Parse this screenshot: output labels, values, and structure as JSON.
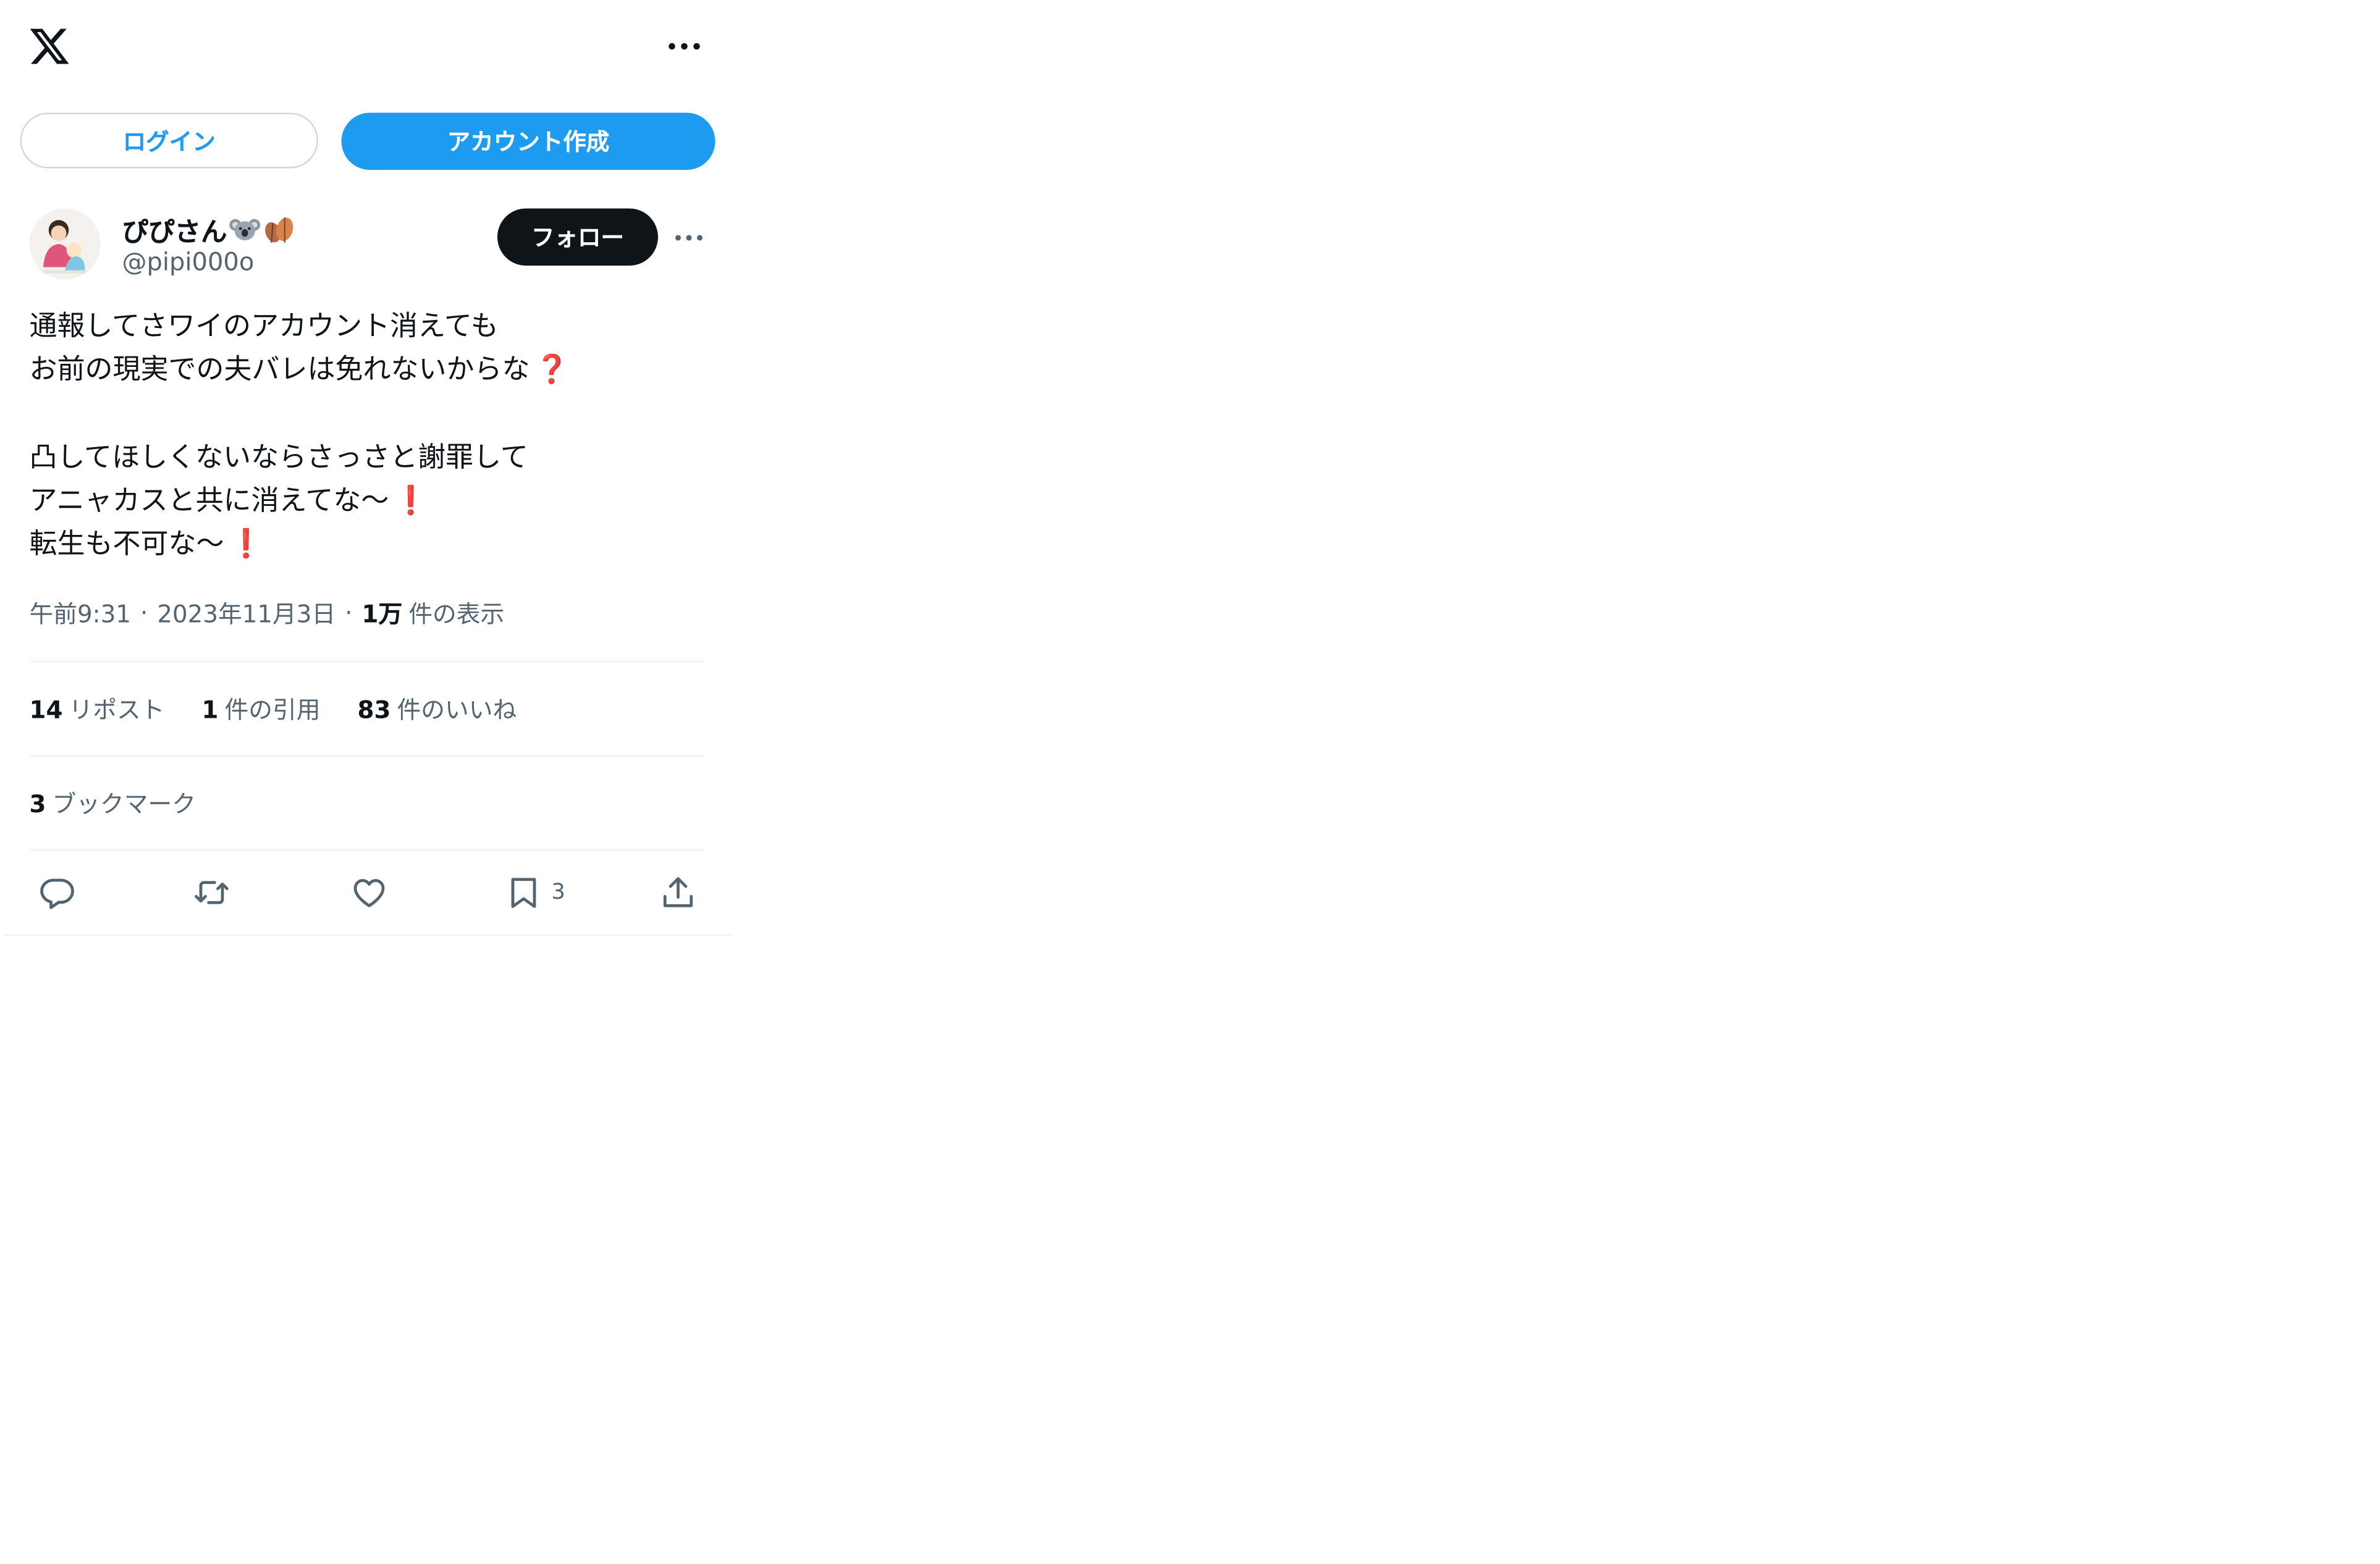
{
  "header": {
    "logo_icon": "x-logo-icon",
    "more_icon": "more-horizontal-icon"
  },
  "auth": {
    "login_label": "ログイン",
    "signup_label": "アカウント作成"
  },
  "author": {
    "display_name": "ぴぴさん",
    "name_emojis": [
      "koala-emoji",
      "leaves-emoji"
    ],
    "handle": "@pipi000o",
    "follow_label": "フォロー"
  },
  "tweet": {
    "lines": [
      "通報してさワイのアカウント消えても",
      "お前の現実での夫バレは免れないからな",
      "",
      "凸してほしくないならさっさと謝罪して",
      "アニャカスと共に消えてな〜",
      "転生も不可な〜"
    ],
    "line_emojis": [
      "",
      "❓",
      "",
      "",
      "❗",
      "❗"
    ]
  },
  "meta": {
    "time": "午前9:31",
    "separator": "·",
    "date": "2023年11月3日",
    "views_count": "1万",
    "views_label": "件の表示"
  },
  "stats": {
    "reposts_count": "14",
    "reposts_label": "リポスト",
    "quotes_count": "1",
    "quotes_label": "件の引用",
    "likes_count": "83",
    "likes_label": "件のいいね",
    "bookmarks_count": "3",
    "bookmarks_label": "ブックマーク"
  },
  "actions": {
    "reply_icon": "reply-icon",
    "repost_icon": "repost-icon",
    "like_icon": "heart-icon",
    "bookmark_icon": "bookmark-icon",
    "bookmark_count": "3",
    "share_icon": "share-icon"
  },
  "colors": {
    "accent": "#1d9bf0",
    "text": "#0f1419",
    "secondary": "#536471",
    "follow_bg": "#0f1419",
    "emoji_red": "#c8102e"
  }
}
